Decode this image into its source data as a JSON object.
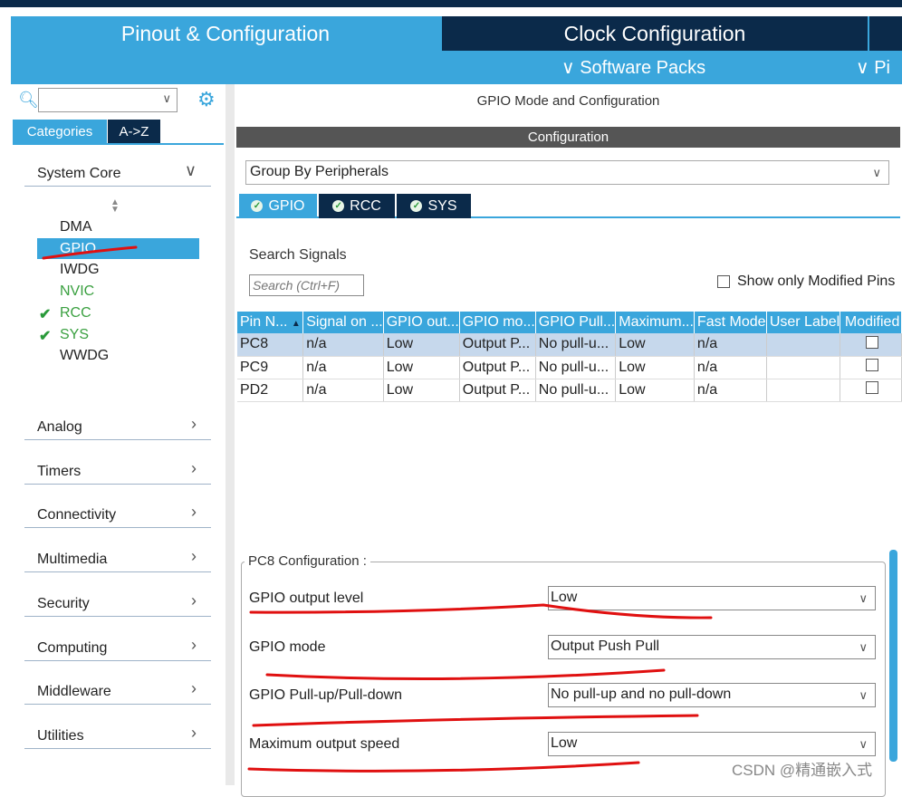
{
  "header": {
    "tab_pinout": "Pinout & Configuration",
    "tab_clock": "Clock Configuration",
    "menu_software": "Software Packs",
    "menu_pinout": "Pi"
  },
  "left": {
    "tab_categories": "Categories",
    "tab_az": "A->Z",
    "system_core": "System Core",
    "sub_items": [
      "DMA",
      "GPIO",
      "IWDG",
      "NVIC",
      "RCC",
      "SYS",
      "WWDG"
    ],
    "categories": [
      "Analog",
      "Timers",
      "Connectivity",
      "Multimedia",
      "Security",
      "Computing",
      "Middleware",
      "Utilities"
    ]
  },
  "right": {
    "mode_title": "GPIO Mode and Configuration",
    "config_bar": "Configuration",
    "group_by": "Group By Peripherals",
    "peripheral_tabs": [
      "GPIO",
      "RCC",
      "SYS"
    ],
    "search_signals_label": "Search Signals",
    "search_placeholder": "Search (Ctrl+F)",
    "show_modified": "Show only Modified Pins",
    "table_headers": [
      "Pin N...",
      "Signal on ...",
      "GPIO out...",
      "GPIO mo...",
      "GPIO Pull...",
      "Maximum...",
      "Fast Mode",
      "User Label",
      "Modified"
    ],
    "rows": [
      [
        "PC8",
        "n/a",
        "Low",
        "Output P...",
        "No pull-u...",
        "Low",
        "n/a",
        ""
      ],
      [
        "PC9",
        "n/a",
        "Low",
        "Output P...",
        "No pull-u...",
        "Low",
        "n/a",
        ""
      ],
      [
        "PD2",
        "n/a",
        "Low",
        "Output P...",
        "No pull-u...",
        "Low",
        "n/a",
        ""
      ]
    ],
    "pc8_config_title": "PC8 Configuration :",
    "config_fields": [
      {
        "label": "GPIO output level",
        "value": "Low"
      },
      {
        "label": "GPIO mode",
        "value": "Output Push Pull"
      },
      {
        "label": "GPIO Pull-up/Pull-down",
        "value": "No pull-up and no pull-down"
      },
      {
        "label": "Maximum output speed",
        "value": "Low"
      }
    ]
  },
  "watermark": "CSDN @精通嵌入式",
  "colors": {
    "accent": "#3aa6dc",
    "dark": "#0b2a4a",
    "annotation": "#e01010"
  }
}
